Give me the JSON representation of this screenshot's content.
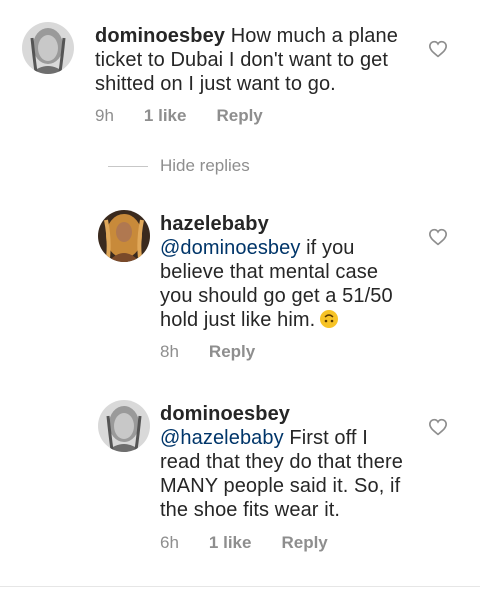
{
  "comments": [
    {
      "username": "dominoesbey",
      "text": " How much a plane ticket to Dubai I don't want to get shitted on I just want to go.",
      "time": "9h",
      "likes": "1 like",
      "reply": "Reply"
    },
    {
      "username": "hazelebaby",
      "mention": "@dominoesbey",
      "text": " if you believe that mental case you should go get a 51/50 hold just like him.",
      "emoji": "upside-down-face",
      "time": "8h",
      "reply": "Reply"
    },
    {
      "username": "dominoesbey",
      "mention": "@hazelebaby",
      "text": " First off I read that they do that there MANY people said it. So,  if the shoe fits wear it.",
      "time": "6h",
      "likes": "1 like",
      "reply": "Reply"
    }
  ],
  "hide_replies": "Hide replies",
  "colors": {
    "text": "#262626",
    "meta": "#8e8e8e",
    "mention": "#003569"
  },
  "icons": {
    "like": "heart-outline-icon"
  }
}
